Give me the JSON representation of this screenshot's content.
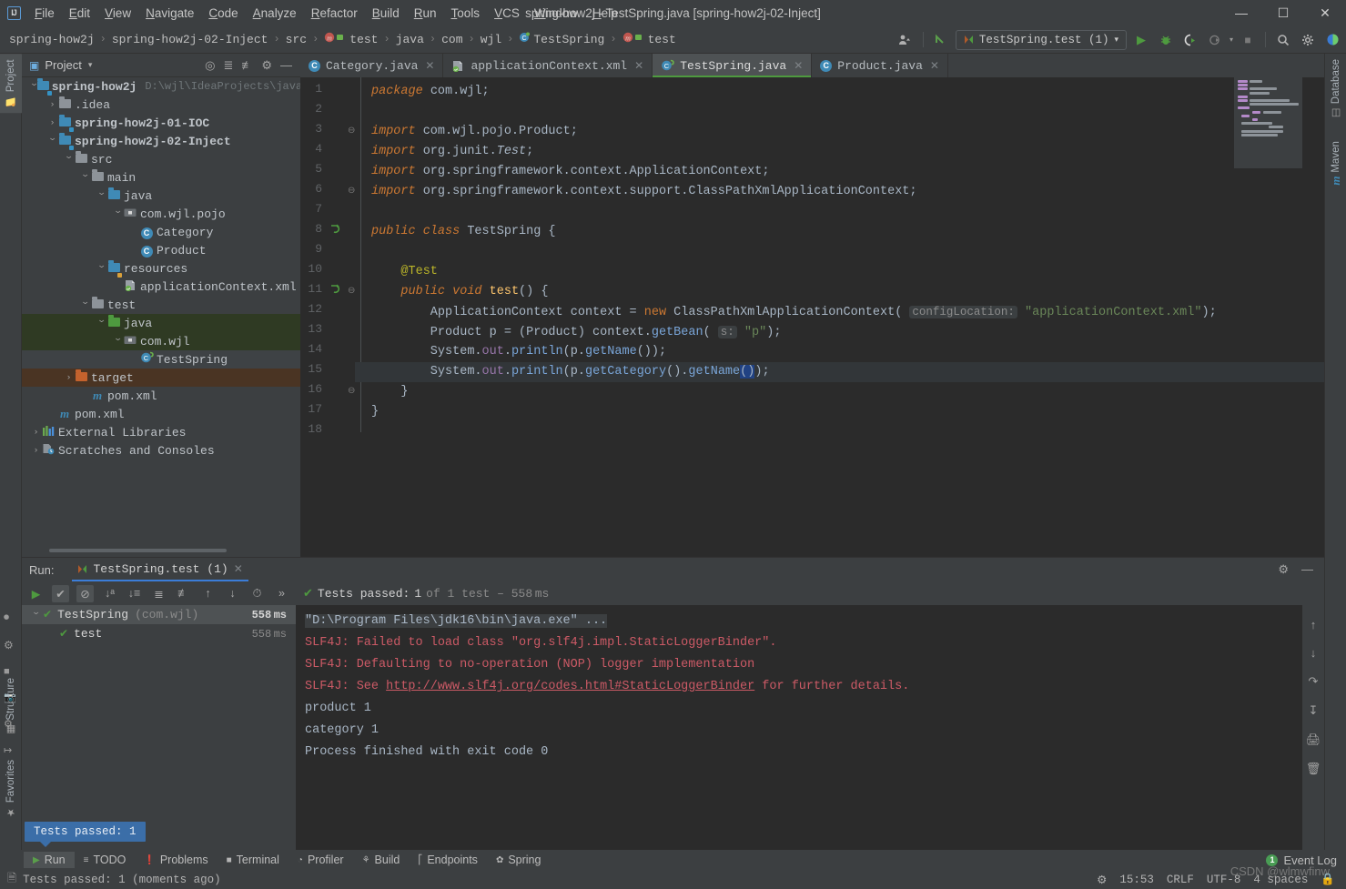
{
  "window": {
    "title": "spring-how2j - TestSpring.java [spring-how2j-02-Inject]",
    "minimize": "—",
    "maximize": "☐",
    "close": "✕",
    "logo": "IJ"
  },
  "menu": {
    "items": [
      "File",
      "Edit",
      "View",
      "Navigate",
      "Code",
      "Analyze",
      "Refactor",
      "Build",
      "Run",
      "Tools",
      "VCS",
      "Window",
      "Help"
    ]
  },
  "breadcrumb": {
    "separator": "›",
    "items": [
      "spring-how2j",
      "spring-how2j-02-Inject",
      "src",
      "test",
      "java",
      "com",
      "wjl",
      "TestSpring",
      "test"
    ]
  },
  "toolbar": {
    "run_config": "TestSpring.test (1)",
    "run_config_caret": "▾",
    "run": "▶",
    "debug": "debug-icon",
    "coverage": "coverage-icon",
    "profile": "profile-icon",
    "stop": "■",
    "search": "⌕",
    "settings": "⚙",
    "user_icon": "user-icon",
    "update_icon": "↖"
  },
  "left_strip": {
    "project": "Project",
    "structure": "Structure",
    "favorites": "Favorites"
  },
  "right_strip": {
    "database": "Database",
    "maven": "Maven"
  },
  "project_panel": {
    "title": "Project",
    "caret": "▾",
    "actions": [
      "locate-icon",
      "expand-all-icon",
      "collapse-all-icon",
      "settings-icon",
      "hide-icon"
    ],
    "tree": [
      {
        "indent": 0,
        "arrow": "⌄",
        "icon": "module-folder",
        "label": "spring-how2j",
        "bold": true,
        "path": "D:\\wjl\\IdeaProjects\\java",
        "state": "none"
      },
      {
        "indent": 1,
        "arrow": "›",
        "icon": "folder-grey",
        "label": ".idea",
        "state": "none"
      },
      {
        "indent": 1,
        "arrow": "›",
        "icon": "module-folder",
        "label": "spring-how2j-01-IOC",
        "bold": true,
        "state": "none"
      },
      {
        "indent": 1,
        "arrow": "⌄",
        "icon": "module-folder",
        "label": "spring-how2j-02-Inject",
        "bold": true,
        "state": "none"
      },
      {
        "indent": 2,
        "arrow": "⌄",
        "icon": "folder-grey",
        "label": "src",
        "state": "none"
      },
      {
        "indent": 3,
        "arrow": "⌄",
        "icon": "folder-grey",
        "label": "main",
        "state": "none"
      },
      {
        "indent": 4,
        "arrow": "⌄",
        "icon": "folder-blue",
        "label": "java",
        "state": "none"
      },
      {
        "indent": 5,
        "arrow": "⌄",
        "icon": "package",
        "label": "com.wjl.pojo",
        "state": "none"
      },
      {
        "indent": 6,
        "arrow": "",
        "icon": "class",
        "label": "Category",
        "state": "none"
      },
      {
        "indent": 6,
        "arrow": "",
        "icon": "class",
        "label": "Product",
        "state": "none"
      },
      {
        "indent": 4,
        "arrow": "⌄",
        "icon": "folder-resources",
        "label": "resources",
        "state": "none"
      },
      {
        "indent": 5,
        "arrow": "",
        "icon": "spring-xml",
        "label": "applicationContext.xml",
        "state": "none"
      },
      {
        "indent": 3,
        "arrow": "⌄",
        "icon": "folder-grey",
        "label": "test",
        "state": "none"
      },
      {
        "indent": 4,
        "arrow": "⌄",
        "icon": "folder-green",
        "label": "java",
        "state": "green"
      },
      {
        "indent": 5,
        "arrow": "⌄",
        "icon": "package",
        "label": "com.wjl",
        "state": "green"
      },
      {
        "indent": 6,
        "arrow": "",
        "icon": "class-spring",
        "label": "TestSpring",
        "state": "grey"
      },
      {
        "indent": 2,
        "arrow": "›",
        "icon": "folder-orange",
        "label": "target",
        "state": "brown"
      },
      {
        "indent": 3,
        "arrow": "",
        "icon": "maven",
        "label": "pom.xml",
        "state": "none"
      },
      {
        "indent": 1,
        "arrow": "",
        "icon": "maven",
        "label": "pom.xml",
        "state": "none"
      },
      {
        "indent": 0,
        "arrow": "›",
        "icon": "libraries",
        "label": "External Libraries",
        "state": "none"
      },
      {
        "indent": 0,
        "arrow": "›",
        "icon": "scratches",
        "label": "Scratches and Consoles",
        "state": "none"
      }
    ]
  },
  "editor": {
    "tabs": [
      {
        "label": "Category.java",
        "icon": "class-icon",
        "active": false
      },
      {
        "label": "applicationContext.xml",
        "icon": "spring-xml-icon",
        "active": false
      },
      {
        "label": "TestSpring.java",
        "icon": "class-spring-icon",
        "active": true
      },
      {
        "label": "Product.java",
        "icon": "class-icon",
        "active": false
      }
    ],
    "line_numbers": [
      "1",
      "2",
      "3",
      "4",
      "5",
      "6",
      "7",
      "8",
      "9",
      "10",
      "11",
      "12",
      "13",
      "14",
      "15",
      "16",
      "17",
      "18"
    ],
    "code_lines": [
      {
        "n": 1,
        "text": "package com.wjl;"
      },
      {
        "n": 2,
        "text": ""
      },
      {
        "n": 3,
        "text": "import com.wjl.pojo.Product;"
      },
      {
        "n": 4,
        "text": "import org.junit.Test;"
      },
      {
        "n": 5,
        "text": "import org.springframework.context.ApplicationContext;"
      },
      {
        "n": 6,
        "text": "import org.springframework.context.support.ClassPathXmlApplicationContext;"
      },
      {
        "n": 7,
        "text": ""
      },
      {
        "n": 8,
        "text": "public class TestSpring {"
      },
      {
        "n": 9,
        "text": ""
      },
      {
        "n": 10,
        "text": "    @Test"
      },
      {
        "n": 11,
        "text": "    public void test() {"
      },
      {
        "n": 12,
        "text": "        ApplicationContext context = new ClassPathXmlApplicationContext( configLocation: \"applicationContext.xml\");"
      },
      {
        "n": 13,
        "text": "        Product p = (Product) context.getBean( s: \"p\");"
      },
      {
        "n": 14,
        "text": "        System.out.println(p.getName());"
      },
      {
        "n": 15,
        "text": "        System.out.println(p.getCategory().getName());"
      },
      {
        "n": 16,
        "text": "    }"
      },
      {
        "n": 17,
        "text": "}"
      },
      {
        "n": 18,
        "text": ""
      }
    ],
    "hints": {
      "config_location": "configLocation:",
      "bean_name": "s:"
    },
    "inspection_status": "✔"
  },
  "run_panel": {
    "label": "Run:",
    "tab": "TestSpring.test (1)",
    "close": "✕",
    "settings_icon": "⚙",
    "hide_icon": "—",
    "toolbar_icons": [
      "rerun-icon",
      "show-passed-icon",
      "show-ignored-icon",
      "sort-alpha-icon",
      "sort-duration-icon",
      "expand-all-icon",
      "collapse-all-icon",
      "prev-failed-icon",
      "next-failed-icon",
      "history-icon",
      "more-icon"
    ],
    "status": {
      "prefix": "Tests passed:",
      "count": "1",
      "suffix": "of 1 test – 558 ms",
      "check": "✔"
    },
    "tests": [
      {
        "indent": 0,
        "arrow": "⌄",
        "label": "TestSpring",
        "suffix": "(com.wjl)",
        "time": "558 ms",
        "selected": true
      },
      {
        "indent": 1,
        "arrow": "",
        "label": "test",
        "suffix": "",
        "time": "558 ms",
        "selected": false
      }
    ],
    "console": [
      {
        "kind": "cmd",
        "text": "\"D:\\Program Files\\jdk16\\bin\\java.exe\" ..."
      },
      {
        "kind": "err",
        "text": "SLF4J: Failed to load class \"org.slf4j.impl.StaticLoggerBinder\"."
      },
      {
        "kind": "err",
        "text": "SLF4J: Defaulting to no-operation (NOP) logger implementation"
      },
      {
        "kind": "link",
        "prefix": "SLF4J: See ",
        "link": "http://www.slf4j.org/codes.html#StaticLoggerBinder",
        "suffix": " for further details."
      },
      {
        "kind": "out",
        "text": "product 1"
      },
      {
        "kind": "out",
        "text": "category 1"
      },
      {
        "kind": "out",
        "text": ""
      },
      {
        "kind": "out",
        "text": "Process finished with exit code 0"
      }
    ],
    "console_rail": [
      "↑",
      "↓",
      "wrap-icon",
      "scroll-end-icon",
      "print-icon",
      "trash-icon"
    ]
  },
  "tooltip": {
    "text": "Tests passed: 1"
  },
  "bottom_bar": {
    "tabs": [
      {
        "label": "Run",
        "icon": "▶",
        "active": true
      },
      {
        "label": "TODO",
        "icon": "list-icon",
        "active": false
      },
      {
        "label": "Problems",
        "icon": "warning-icon",
        "active": false
      },
      {
        "label": "Terminal",
        "icon": "terminal-icon",
        "active": false
      },
      {
        "label": "Profiler",
        "icon": "profiler-icon",
        "active": false
      },
      {
        "label": "Build",
        "icon": "hammer-icon",
        "active": false
      },
      {
        "label": "Endpoints",
        "icon": "endpoints-icon",
        "active": false
      },
      {
        "label": "Spring",
        "icon": "spring-leaf-icon",
        "active": false
      }
    ],
    "event_log": {
      "label": "Event Log",
      "count": "1"
    }
  },
  "status_bar": {
    "message": "Tests passed: 1 (moments ago)",
    "time": "15:53",
    "line_sep": "CRLF",
    "encoding": "UTF-8",
    "indent": "4 spaces",
    "lock_icon": "lock-icon"
  },
  "watermark": "CSDN @wlmwfinw",
  "colors": {
    "accent_green": "#4e9a3f",
    "tooltip_blue": "#3b6ea8",
    "panel_bg": "#3c3f41",
    "editor_bg": "#2b2b2b",
    "error_red": "#cc5a66",
    "keyword_orange": "#cc7832",
    "string_green": "#6a8759"
  }
}
